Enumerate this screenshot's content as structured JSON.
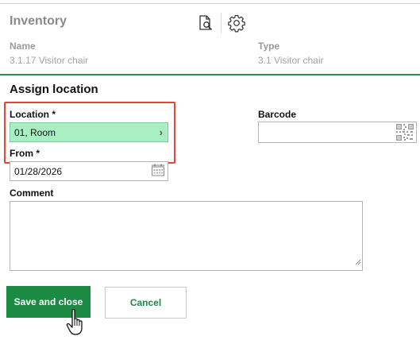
{
  "header": {
    "title": "Inventory",
    "preview_icon": "document-search-icon",
    "settings_icon": "gear-icon"
  },
  "info": {
    "name_label": "Name",
    "name_value": "3.1.17 Visitor chair",
    "type_label": "Type",
    "type_value": "3.1 Visitor chair"
  },
  "form": {
    "section_title": "Assign location",
    "location_label": "Location *",
    "location_value": "01, Room",
    "from_label": "From *",
    "from_value": "01/28/2026",
    "barcode_label": "Barcode",
    "barcode_value": "",
    "comment_label": "Comment",
    "comment_value": ""
  },
  "buttons": {
    "save": "Save and close",
    "cancel": "Cancel"
  },
  "colors": {
    "accent_green": "#1b8a42",
    "location_highlight": "#a8f0c4",
    "focus_outline": "#e0443a"
  }
}
